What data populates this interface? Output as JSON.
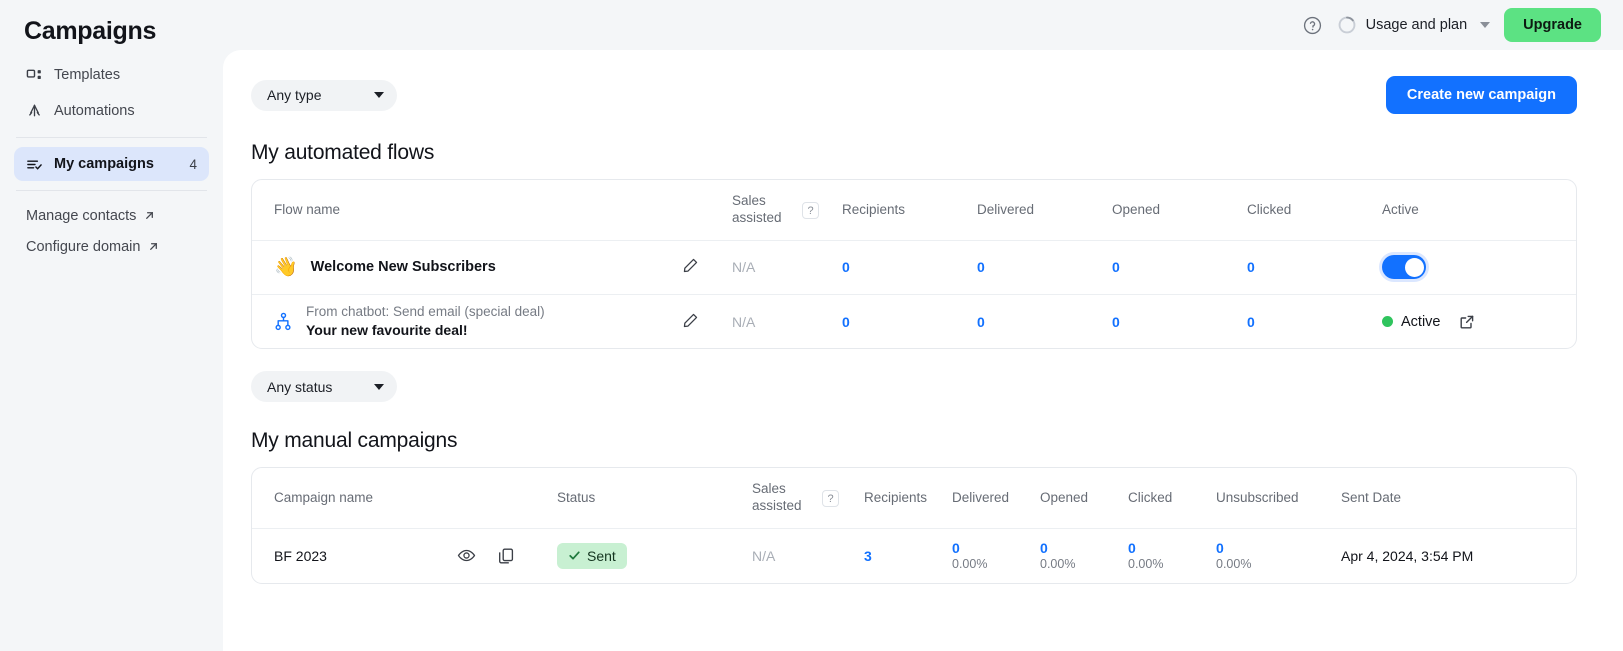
{
  "sidebar": {
    "brand": "Campaigns",
    "items": [
      {
        "label": "Templates",
        "icon": "templates-icon",
        "count": ""
      },
      {
        "label": "Automations",
        "icon": "automations-icon",
        "count": ""
      },
      {
        "label": "My campaigns",
        "icon": "my-campaigns-icon",
        "count": "4"
      }
    ],
    "external": [
      {
        "label": "Manage contacts",
        "icon": "external-link-icon"
      },
      {
        "label": "Configure domain",
        "icon": "external-link-icon"
      }
    ]
  },
  "topbar": {
    "help_icon": "help-circle-icon",
    "usage_label": "Usage and plan",
    "usage_icon": "usage-ring-icon",
    "caret_icon": "chevron-down-icon",
    "upgrade_label": "Upgrade",
    "upgrade_color": "#5ce283"
  },
  "filters": {
    "type_label": "Any type",
    "status_label": "Any status",
    "create_label": "Create new campaign",
    "create_color": "#1271ff"
  },
  "flows": {
    "title": "My automated flows",
    "columns": [
      "Flow name",
      "Sales assisted",
      "Recipients",
      "Delivered",
      "Opened",
      "Clicked",
      "Active"
    ],
    "help_badge": "?",
    "rows": [
      {
        "icon": "wave-hand-icon",
        "name": "Welcome New Subscribers",
        "subtitle": "",
        "edit_icon": "pencil-icon",
        "sales_assisted": "N/A",
        "recipients": "0",
        "delivered": "0",
        "opened": "0",
        "clicked": "0",
        "active_type": "toggle",
        "active_label": "",
        "toggle_on": true
      },
      {
        "icon": "flow-node-icon",
        "name": "Your new favourite deal!",
        "subtitle": "From chatbot: Send email (special deal)",
        "edit_icon": "pencil-icon",
        "sales_assisted": "N/A",
        "recipients": "0",
        "delivered": "0",
        "opened": "0",
        "clicked": "0",
        "active_type": "status",
        "active_label": "Active",
        "status_color": "#2fc45d",
        "open_icon": "external-link-icon"
      }
    ]
  },
  "campaigns": {
    "title": "My manual campaigns",
    "columns": [
      "Campaign name",
      "Status",
      "Sales assisted",
      "Recipients",
      "Delivered",
      "Opened",
      "Clicked",
      "Unsubscribed",
      "Sent Date"
    ],
    "help_badge": "?",
    "rows": [
      {
        "name": "BF 2023",
        "preview_icon": "eye-icon",
        "duplicate_icon": "copy-icon",
        "status": "Sent",
        "status_icon": "check-icon",
        "sales_assisted": "N/A",
        "recipients": "3",
        "delivered": "0",
        "delivered_pct": "0.00%",
        "opened": "0",
        "opened_pct": "0.00%",
        "clicked": "0",
        "clicked_pct": "0.00%",
        "unsubscribed": "0",
        "unsubscribed_pct": "0.00%",
        "sent_date": "Apr 4, 2024, 3:54 PM"
      }
    ]
  }
}
